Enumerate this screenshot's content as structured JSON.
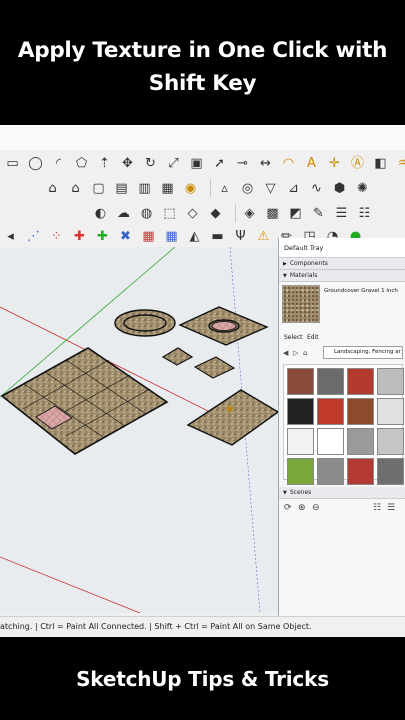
{
  "overlay": {
    "title_line_1": "Apply Texture in One Click with",
    "title_line_2": "Shift Key",
    "footer": "SketchUp Tips & Tricks"
  },
  "tray": {
    "title": "Default Tray",
    "components_label": "Components",
    "materials_label": "Materials",
    "material_name": "Groundcover Gravel 1 inch",
    "tab_select": "Select",
    "tab_edit": "Edit",
    "library": "Landscaping, Fencing ar",
    "scenes_label": "Scenes"
  },
  "status": {
    "text": "atching. | Ctrl = Paint All Connected. | Shift + Ctrl = Paint All on Same Object."
  },
  "toolbars": {
    "row1_icons": [
      "rectangle-icon",
      "circle-icon",
      "arc-icon",
      "polygon-icon",
      "push-pull-icon",
      "move-icon",
      "rotate-icon",
      "scale-icon",
      "offset-icon",
      "follow-me-icon",
      "tape-icon",
      "dimension-icon",
      "protractor-icon",
      "text-icon",
      "axes-icon",
      "3d-text-icon",
      "section-icon",
      "paint-icon",
      "eraser-icon",
      "select-icon",
      "orbit-icon",
      "pan-icon",
      "zoom-icon",
      "zoom-extents-icon"
    ],
    "row2_icons": [
      "house-icon",
      "home-view-icon",
      "top-view-icon",
      "front-view-icon",
      "right-view-icon",
      "back-view-icon",
      "camera-icon",
      "sandbox-icon",
      "contour-icon",
      "drape-icon",
      "flip-icon",
      "smoove-icon",
      "stamp-icon",
      "add-detail-icon"
    ],
    "row3_icons": [
      "shadow-icon",
      "fog-icon",
      "xray-icon",
      "back-edges-icon",
      "wireframe-icon",
      "hidden-line-icon",
      "shaded-icon",
      "textured-icon",
      "monochrome-icon",
      "style-icon",
      "layer-icon",
      "outliner-icon"
    ],
    "row4_icons": [
      "arrow-left-icon",
      "line-dots-icon",
      "curve-dots-icon",
      "plus-red-icon",
      "plus-green-icon",
      "cross-blue-icon",
      "grid-red-icon",
      "grid-blue-icon",
      "triangle-icon",
      "bar-icon",
      "trident-icon",
      "warning-icon",
      "pencil-icon",
      "nested-icon",
      "round-icon",
      "sphere-icon"
    ]
  },
  "materials": {
    "swatches": [
      {
        "name": "brick-swatch",
        "color": "#8a4a3c"
      },
      {
        "name": "tile-swatch",
        "color": "#6b6b6b"
      },
      {
        "name": "red-swatch",
        "color": "#b23a2e"
      },
      {
        "name": "plank-swatch",
        "color": "#bdbdbd"
      },
      {
        "name": "lattice-swatch",
        "color": "#222222"
      },
      {
        "name": "red-lattice-swatch",
        "color": "#c0392b"
      },
      {
        "name": "cross-swatch",
        "color": "#8e4b2c"
      },
      {
        "name": "fence-swatch",
        "color": "#e0e0e0"
      },
      {
        "name": "picket-swatch",
        "color": "#f2f2f2"
      },
      {
        "name": "white-fence-swatch",
        "color": "#ffffff"
      },
      {
        "name": "wood-swatch",
        "color": "#9a9a9a"
      },
      {
        "name": "stone-swatch",
        "color": "#c5c5c5"
      },
      {
        "name": "grass-swatch",
        "color": "#7ba83a"
      },
      {
        "name": "gravel-swatch",
        "color": "#8c8c8c"
      },
      {
        "name": "red-gravel-swatch",
        "color": "#b33b33"
      },
      {
        "name": "dark-gravel-swatch",
        "color": "#6e6e6e"
      }
    ]
  }
}
